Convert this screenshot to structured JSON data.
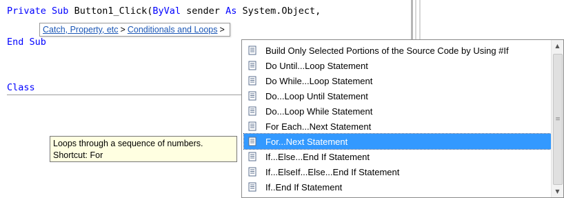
{
  "code": {
    "line1": {
      "kw1": "Private",
      "kw2": "Sub",
      "plain1": "Button1_Click(",
      "kw3": "ByVal",
      "plain2": "sender",
      "kw4": "As",
      "plain3": "System.Object,"
    },
    "line2": {
      "kw1": "End",
      "kw2": "Sub"
    },
    "line3": {
      "kw1": "Class"
    }
  },
  "breadcrumb": {
    "item1": "Catch, Property, etc",
    "sep": ">",
    "item2": "Conditionals and Loops",
    "sep2": ">"
  },
  "tooltip": {
    "line1": "Loops through a sequence of numbers.",
    "line2": "Shortcut: For"
  },
  "snippet_list": {
    "icon": "snippet-document-icon",
    "items": [
      {
        "label": "Build Only Selected Portions of the Source Code by Using #If"
      },
      {
        "label": "Do Until...Loop Statement"
      },
      {
        "label": "Do While...Loop Statement"
      },
      {
        "label": "Do...Loop Until Statement"
      },
      {
        "label": "Do...Loop While Statement"
      },
      {
        "label": "For Each...Next Statement"
      },
      {
        "label": "For...Next Statement"
      },
      {
        "label": "If...Else...End If Statement"
      },
      {
        "label": "If...ElseIf...Else...End If Statement"
      },
      {
        "label": "If..End If Statement"
      }
    ],
    "selected_index": 6,
    "colors": {
      "selection": "#3399ff",
      "keyword": "#0000ff",
      "tooltip_bg": "#ffffe1"
    }
  }
}
